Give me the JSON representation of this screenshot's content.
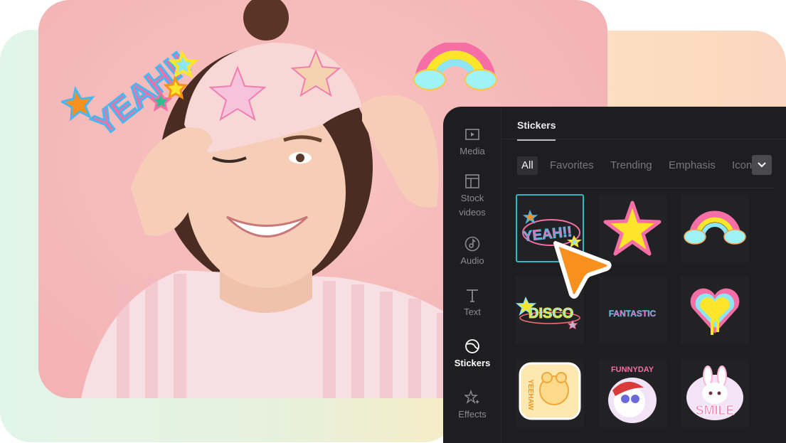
{
  "editor": {
    "sidebar": {
      "items": [
        {
          "label": "Media",
          "icon": "play-square-icon",
          "active": false
        },
        {
          "label": "Stock videos",
          "label_line1": "Stock",
          "label_line2": "videos",
          "icon": "layout-icon",
          "active": false
        },
        {
          "label": "Audio",
          "icon": "music-note-icon",
          "active": false
        },
        {
          "label": "Text",
          "icon": "text-t-icon",
          "active": false
        },
        {
          "label": "Stickers",
          "icon": "sticker-icon",
          "active": true
        },
        {
          "label": "Effects",
          "icon": "sparkle-star-icon",
          "active": false
        }
      ]
    },
    "tab": {
      "label": "Stickers"
    },
    "filters": [
      {
        "label": "All",
        "active": true
      },
      {
        "label": "Favorites",
        "active": false
      },
      {
        "label": "Trending",
        "active": false
      },
      {
        "label": "Emphasis",
        "active": false
      },
      {
        "label": "Icon",
        "active": false
      }
    ],
    "filter_more_icon": "chevron-down-icon",
    "stickers": [
      {
        "name": "YEAH!!",
        "text": "YEAH!!",
        "selected": true
      },
      {
        "name": "Star",
        "text": "",
        "selected": false
      },
      {
        "name": "Rainbow",
        "text": "",
        "selected": false
      },
      {
        "name": "DISCO",
        "text": "DISCO",
        "selected": false
      },
      {
        "name": "FANTASTIC",
        "text": "FANTASTIC",
        "selected": false
      },
      {
        "name": "Heart",
        "text": "",
        "selected": false
      },
      {
        "name": "YEEHAW",
        "text": "YEEHAW",
        "selected": false
      },
      {
        "name": "FUNNYDAY",
        "text": "FUNNYDAY",
        "selected": false
      },
      {
        "name": "SMILE",
        "text": "SMILE",
        "selected": false
      }
    ]
  },
  "canvas": {
    "overlay_stickers": [
      {
        "name": "YEAH!!",
        "text": "YEAH!!"
      },
      {
        "name": "Rainbow",
        "text": ""
      }
    ]
  },
  "colors": {
    "panel_bg": "#1e1e20",
    "selected_border": "#2fb8c2",
    "cursor": "#f7901e",
    "photo_bg": "#f6bcbd",
    "sticker_pink": "#f56fa6",
    "sticker_yellow": "#fde52c",
    "sticker_cyan": "#8ee6f5"
  }
}
